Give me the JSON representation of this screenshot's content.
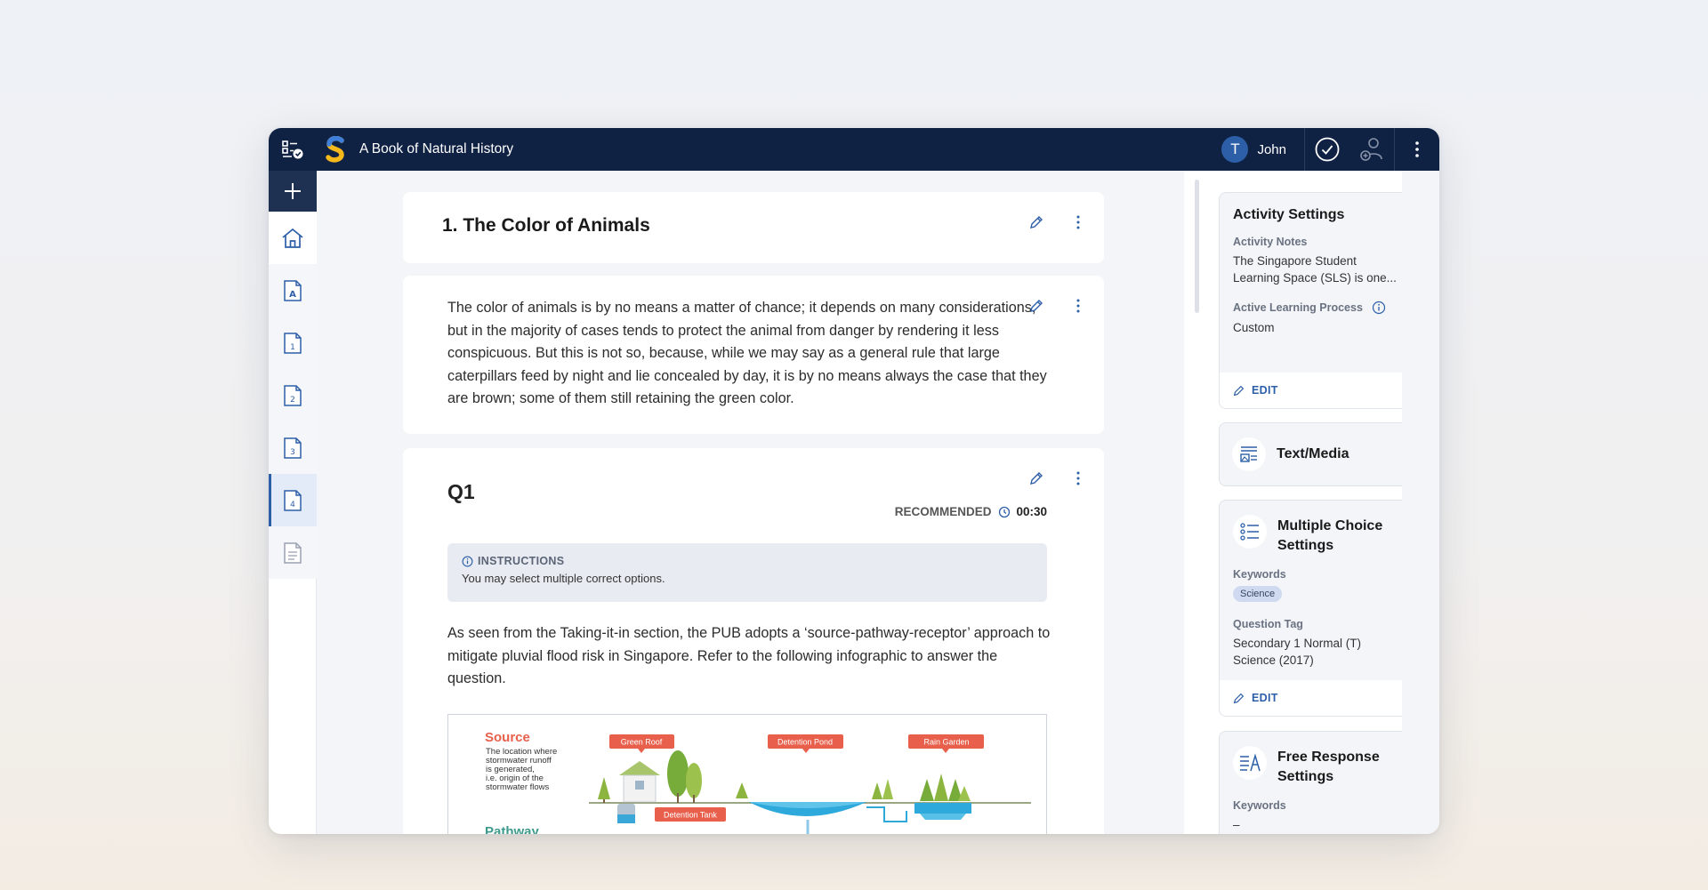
{
  "app": {
    "title": "A Book of Natural History",
    "user_initial": "T",
    "user_name": "John"
  },
  "icons": {
    "apps": "apps-checklist-icon",
    "logo": "sls-logo-icon",
    "complete": "check-circle-icon",
    "collaborators": "add-collaborator-icon",
    "more": "more-vertical-icon"
  },
  "colors": {
    "topbar": "#102244",
    "accent": "#2d5fa8",
    "logo_yellow": "#f5b91b"
  },
  "nav": {
    "items": [
      {
        "name": "home",
        "label": ""
      },
      {
        "name": "page-a",
        "label": "A"
      },
      {
        "name": "page-1",
        "label": "1"
      },
      {
        "name": "page-2",
        "label": "2"
      },
      {
        "name": "page-3",
        "label": "3"
      },
      {
        "name": "page-4",
        "label": "4"
      },
      {
        "name": "notes",
        "label": ""
      }
    ],
    "active_index": 5
  },
  "section": {
    "title": "1. The Color of Animals"
  },
  "paragraph": {
    "text": "The color of animals is by no means a matter of chance; it depends on many considerations, but in the majority of cases tends to protect the animal from danger by rendering it less conspicuous. But this is not so, because, while we may say as a general rule that large caterpillars feed by night and lie concealed by day, it is by no means always the case that they are brown; some of them still retaining the green color."
  },
  "question": {
    "title": "Q1",
    "recommended_label": "RECOMMENDED",
    "recommended_time": "00:30",
    "instructions_heading": "INSTRUCTIONS",
    "instructions_text": "You may select multiple correct options.",
    "text": "As seen from the Taking-it-in section, the PUB adopts a ‘source-pathway-receptor’ approach to mitigate pluvial flood risk in Singapore. Refer to the following infographic to answer the question."
  },
  "infographic": {
    "source_title": "Source",
    "source_desc_1": "The location where",
    "source_desc_2": "stormwater runoff",
    "source_desc_3": "is generated,",
    "source_desc_4": "i.e. origin of the",
    "source_desc_5": "stormwater flows",
    "pathway_title": "Pathway",
    "tag_green_roof": "Green Roof",
    "tag_detention_tank": "Detention Tank",
    "tag_detention_pond": "Detention Pond",
    "tag_rain_garden": "Rain Garden"
  },
  "right_panel": {
    "activity": {
      "title": "Activity Settings",
      "notes_label": "Activity Notes",
      "notes_line1": "The Singapore Student",
      "notes_line2": "Learning Space (SLS) is one...",
      "process_label": "Active Learning Process",
      "process_value": "Custom",
      "edit": "EDIT"
    },
    "text_media": {
      "title": "Text/Media"
    },
    "mcq": {
      "title_line1": "Multiple Choice",
      "title_line2": "Settings",
      "keywords_label": "Keywords",
      "keyword": "Science",
      "tag_label": "Question Tag",
      "tag_line1": "Secondary 1 Normal (T)",
      "tag_line2": "Science (2017)",
      "edit": "EDIT"
    },
    "free_response": {
      "title_line1": "Free Response",
      "title_line2": "Settings",
      "keywords_label": "Keywords",
      "keyword_value": "–"
    }
  }
}
